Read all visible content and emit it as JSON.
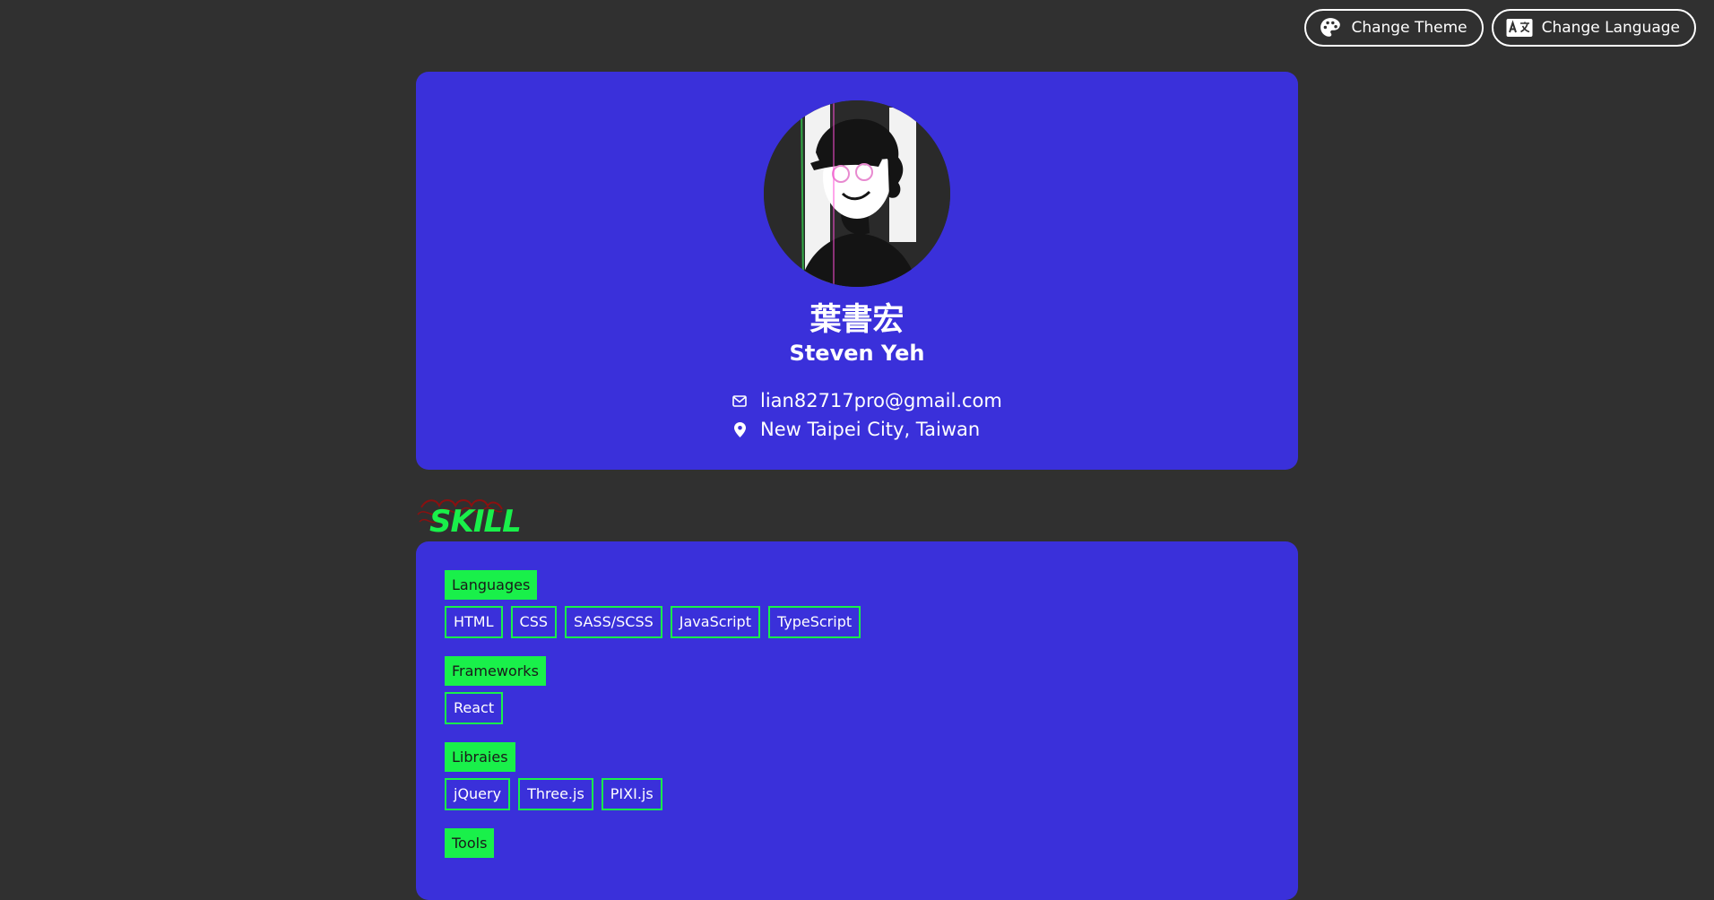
{
  "header": {
    "theme_button": "Change Theme",
    "language_button": "Change Language"
  },
  "profile": {
    "name_zh": "葉書宏",
    "name_en": "Steven Yeh",
    "email": "lian82717pro@gmail.com",
    "location": "New Taipei City, Taiwan"
  },
  "skill_section": {
    "title": "SKILL",
    "groups": [
      {
        "label": "Languages",
        "items": [
          "HTML",
          "CSS",
          "SASS/SCSS",
          "JavaScript",
          "TypeScript"
        ]
      },
      {
        "label": "Frameworks",
        "items": [
          "React"
        ]
      },
      {
        "label": "Libraies",
        "items": [
          "jQuery",
          "Three.js",
          "PIXI.js"
        ]
      },
      {
        "label": "Tools",
        "items": []
      }
    ]
  },
  "colors": {
    "background": "#303030",
    "card": "#3a30da",
    "accent": "#19f04a"
  }
}
